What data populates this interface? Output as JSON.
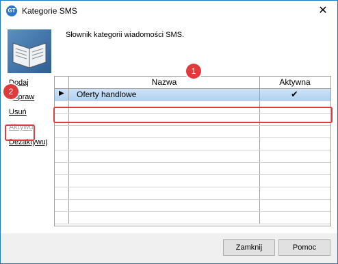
{
  "window": {
    "title": "Kategorie SMS",
    "close_glyph": "✕"
  },
  "description": "Słownik kategorii wiadomości SMS.",
  "sidebar": {
    "items": [
      {
        "label": "Dodaj",
        "enabled": true
      },
      {
        "label": "Popraw",
        "enabled": true
      },
      {
        "label": "Usuń",
        "enabled": true
      },
      {
        "label": "Aktywuj",
        "enabled": false
      },
      {
        "label": "Dezaktywuj",
        "enabled": true
      }
    ]
  },
  "grid": {
    "columns": [
      "Nazwa",
      "Aktywna"
    ],
    "rows": [
      {
        "name": "Oferty handlowe",
        "active": true
      }
    ],
    "selected_row_indicator": "▶",
    "checkmark": "✔"
  },
  "callouts": {
    "one": "1",
    "two": "2"
  },
  "buttons": {
    "close_label": "Zamknij",
    "help_label": "Pomoc"
  },
  "colors": {
    "accent": "#1a78c8",
    "callout": "#e03b3b",
    "selection": "#b8d6f4"
  }
}
